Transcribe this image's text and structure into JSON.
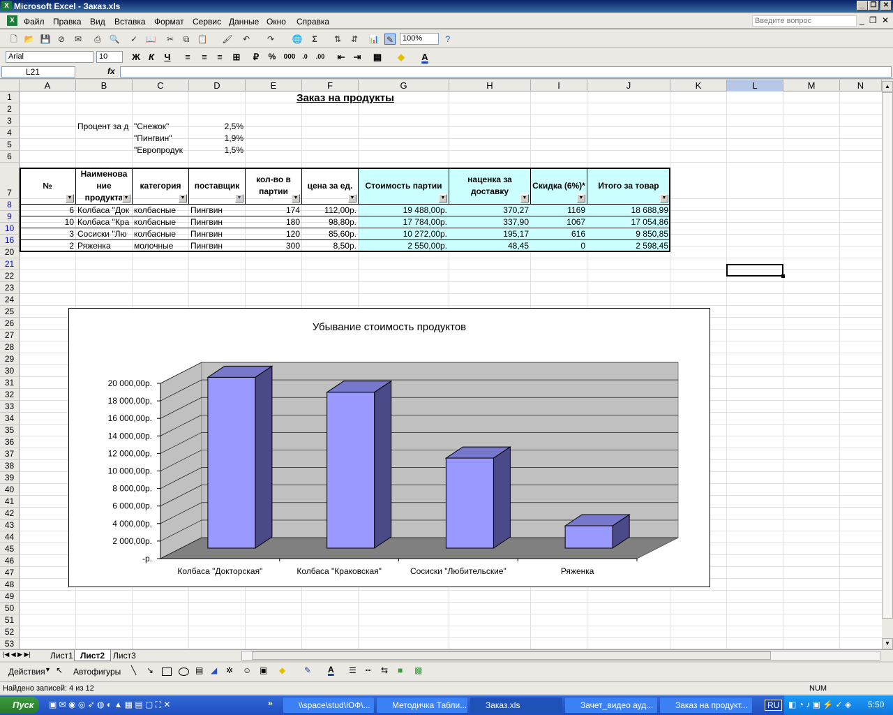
{
  "window": {
    "title": "Microsoft Excel - Заказ.xls",
    "ask_placeholder": "Введите вопрос"
  },
  "menu": [
    "Файл",
    "Правка",
    "Вид",
    "Вставка",
    "Формат",
    "Сервис",
    "Данные",
    "Окно",
    "Справка"
  ],
  "toolbar": {
    "zoom": "100%",
    "font": "Arial",
    "size": "10",
    "bold": "Ж",
    "italic": "К",
    "underline": "Ч",
    "percent": "%",
    "thousands": "000"
  },
  "formula": {
    "name_box": "L21",
    "fx": "fx",
    "content": ""
  },
  "columns": [
    "A",
    "B",
    "C",
    "D",
    "E",
    "F",
    "G",
    "H",
    "I",
    "J",
    "K",
    "L",
    "M",
    "N"
  ],
  "rows": [
    "1",
    "2",
    "3",
    "4",
    "5",
    "6",
    "7",
    "8",
    "9",
    "10",
    "16",
    "20",
    "21",
    "22",
    "23",
    "24",
    "25",
    "26",
    "27",
    "28",
    "29",
    "30",
    "31",
    "32",
    "33",
    "34",
    "35",
    "36",
    "37",
    "38",
    "39",
    "40",
    "41",
    "42",
    "43",
    "44",
    "45",
    "46",
    "47",
    "48",
    "49",
    "50",
    "51",
    "52",
    "53"
  ],
  "sheet": {
    "title": "Заказ на продукты",
    "percent_label": "Процент за д",
    "suppliers": [
      {
        "name": "\"Снежок\"",
        "pct": "2,5%"
      },
      {
        "name": "\"Пингвин\"",
        "pct": "1,9%"
      },
      {
        "name": "\"Европродук",
        "pct": "1,5%"
      }
    ],
    "headers": [
      "№",
      "Наименова ние продукта",
      "категория",
      "поставщик",
      "кол-во в партии",
      "цена за ед.",
      "Стоимость партии",
      "наценка за доставку",
      "Скидка (6%)*",
      "Итого за товар"
    ],
    "data": [
      [
        "6",
        "Колбаса \"Док",
        "колбасные",
        "Пингвин",
        "174",
        "112,00р.",
        "19 488,00р.",
        "370,27",
        "1169",
        "18 688,99"
      ],
      [
        "10",
        "Колбаса \"Кра",
        "колбасные",
        "Пингвин",
        "180",
        "98,80р.",
        "17 784,00р.",
        "337,90",
        "1067",
        "17 054,86"
      ],
      [
        "3",
        "Сосиски \"Лю",
        "колбасные",
        "Пингвин",
        "120",
        "85,60р.",
        "10 272,00р.",
        "195,17",
        "616",
        "9 850,85"
      ],
      [
        "2",
        "Ряженка",
        "молочные",
        "Пингвин",
        "300",
        "8,50р.",
        "2 550,00р.",
        "48,45",
        "0",
        "2 598,45"
      ]
    ]
  },
  "chart_data": {
    "type": "bar",
    "title": "Убывание стоимость продуктов",
    "categories": [
      "Колбаса \"Докторская\"",
      "Колбаса \"Краковская\"",
      "Сосиски \"Любительские\"",
      "Ряженка"
    ],
    "values": [
      19488,
      17784,
      10272,
      2550
    ],
    "yticks": [
      "-р.",
      "2 000,00р.",
      "4 000,00р.",
      "6 000,00р.",
      "8 000,00р.",
      "10 000,00р.",
      "12 000,00р.",
      "14 000,00р.",
      "16 000,00р.",
      "18 000,00р.",
      "20 000,00р."
    ],
    "ylim": [
      0,
      20000
    ],
    "grid": true,
    "bar_color": "#9999ff"
  },
  "tabs": [
    "Лист1",
    "Лист2",
    "Лист3"
  ],
  "drawbar": {
    "actions": "Действия",
    "autoshapes": "Автофигуры"
  },
  "status": {
    "text": "Найдено записей: 4 из 12",
    "num": "NUM"
  },
  "taskbar": {
    "start": "Пуск",
    "tasks": [
      "\\\\space\\stud\\ЮФ\\...",
      "Методичка Табли...",
      "Заказ.xls",
      "Зачет_видео ауд...",
      "Заказ на продукт..."
    ],
    "lang": "RU",
    "clock": "5:50"
  }
}
